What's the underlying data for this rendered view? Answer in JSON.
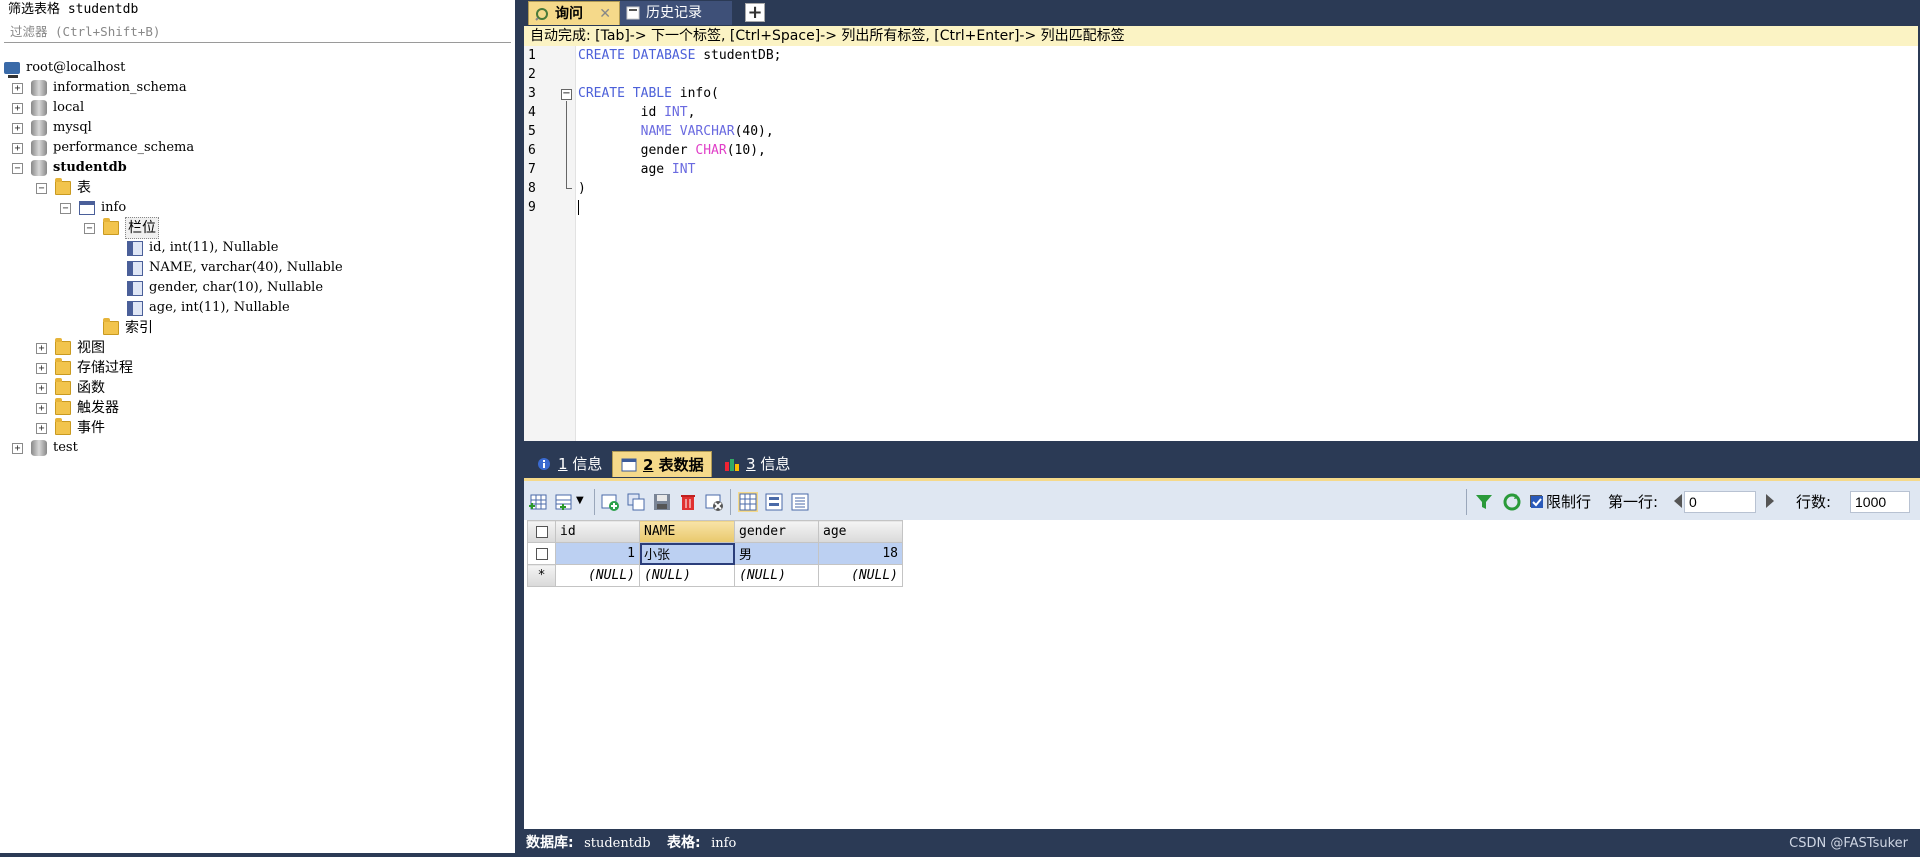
{
  "left_panel": {
    "filter_title": "筛选表格 studentdb",
    "filter_placeholder": "过滤器 (Ctrl+Shift+B)",
    "tree": {
      "root": "root@localhost",
      "dbs": [
        "information_schema",
        "local",
        "mysql",
        "performance_schema"
      ],
      "studentdb": "studentdb",
      "tables_folder": "表",
      "table_info": "info",
      "columns_folder": "栏位",
      "columns": [
        "id, int(11), Nullable",
        "NAME, varchar(40), Nullable",
        "gender, char(10), Nullable",
        "age, int(11), Nullable"
      ],
      "indexes_folder": "索引",
      "folders": [
        "视图",
        "存储过程",
        "函数",
        "触发器",
        "事件"
      ],
      "test_db": "test"
    }
  },
  "editor": {
    "tabs": {
      "query": "询问",
      "history": "历史记录"
    },
    "hint": "自动完成: [Tab]-> 下一个标签, [Ctrl+Space]-> 列出所有标签, [Ctrl+Enter]-> 列出匹配标签",
    "line_numbers": [
      "1",
      "2",
      "3",
      "4",
      "5",
      "6",
      "7",
      "8",
      "9"
    ]
  },
  "result": {
    "tabs": [
      {
        "num": "1",
        "label": "信息"
      },
      {
        "num": "2",
        "label": "表数据"
      },
      {
        "num": "3",
        "label": "信息"
      }
    ],
    "toolbar": {
      "limit_label": "限制行",
      "first_row_label": "第一行:",
      "first_row_value": "0",
      "rows_label": "行数:",
      "rows_value": "1000"
    },
    "grid": {
      "headers": [
        "id",
        "NAME",
        "gender",
        "age"
      ],
      "row": {
        "id": "1",
        "NAME": "小张",
        "gender": "男",
        "age": "18"
      },
      "null_text": "(NULL)",
      "new_row_marker": "*"
    }
  },
  "status": {
    "db_label": "数据库:",
    "db_value": "studentdb",
    "table_label": "表格:",
    "table_value": "info",
    "watermark": "CSDN @FASTsuker"
  },
  "colors": {
    "frame": "#2b3a55",
    "active_tab": "#f5d98a",
    "keyword": "#4c60d9",
    "type_char": "#e040c8"
  }
}
